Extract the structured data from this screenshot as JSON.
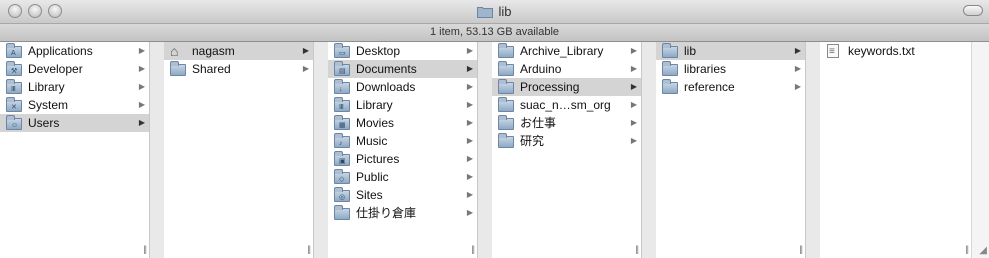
{
  "window": {
    "title": "lib",
    "status": "1 item, 53.13 GB available"
  },
  "columns": [
    {
      "items": [
        {
          "label": "Applications",
          "icon": "applications-folder-icon",
          "selected": false
        },
        {
          "label": "Developer",
          "icon": "developer-folder-icon",
          "selected": false
        },
        {
          "label": "Library",
          "icon": "library-folder-icon",
          "selected": false
        },
        {
          "label": "System",
          "icon": "system-folder-icon",
          "selected": false
        },
        {
          "label": "Users",
          "icon": "users-folder-icon",
          "selected": true
        }
      ]
    },
    {
      "items": [
        {
          "label": "nagasm",
          "icon": "home-icon",
          "selected": true
        },
        {
          "label": "Shared",
          "icon": "folder-icon",
          "selected": false
        }
      ]
    },
    {
      "items": [
        {
          "label": "Desktop",
          "icon": "desktop-folder-icon",
          "selected": false
        },
        {
          "label": "Documents",
          "icon": "documents-folder-icon",
          "selected": true
        },
        {
          "label": "Downloads",
          "icon": "downloads-folder-icon",
          "selected": false
        },
        {
          "label": "Library",
          "icon": "library-folder-icon",
          "selected": false
        },
        {
          "label": "Movies",
          "icon": "movies-folder-icon",
          "selected": false
        },
        {
          "label": "Music",
          "icon": "music-folder-icon",
          "selected": false
        },
        {
          "label": "Pictures",
          "icon": "pictures-folder-icon",
          "selected": false
        },
        {
          "label": "Public",
          "icon": "public-folder-icon",
          "selected": false
        },
        {
          "label": "Sites",
          "icon": "sites-folder-icon",
          "selected": false
        },
        {
          "label": "仕掛り倉庫",
          "icon": "folder-icon",
          "selected": false
        }
      ]
    },
    {
      "items": [
        {
          "label": "Archive_Library",
          "icon": "folder-icon",
          "selected": false
        },
        {
          "label": "Arduino",
          "icon": "folder-icon",
          "selected": false
        },
        {
          "label": "Processing",
          "icon": "folder-icon",
          "selected": true
        },
        {
          "label": "suac_n…sm_org",
          "icon": "folder-icon",
          "selected": false
        },
        {
          "label": "お仕事",
          "icon": "folder-icon",
          "selected": false
        },
        {
          "label": "研究",
          "icon": "folder-icon",
          "selected": false
        }
      ]
    },
    {
      "items": [
        {
          "label": "lib",
          "icon": "folder-icon",
          "selected": true
        },
        {
          "label": "libraries",
          "icon": "folder-icon",
          "selected": false
        },
        {
          "label": "reference",
          "icon": "folder-icon",
          "selected": false
        }
      ]
    },
    {
      "items": [
        {
          "label": "keywords.txt",
          "icon": "text-file-icon",
          "selected": false
        }
      ]
    }
  ]
}
